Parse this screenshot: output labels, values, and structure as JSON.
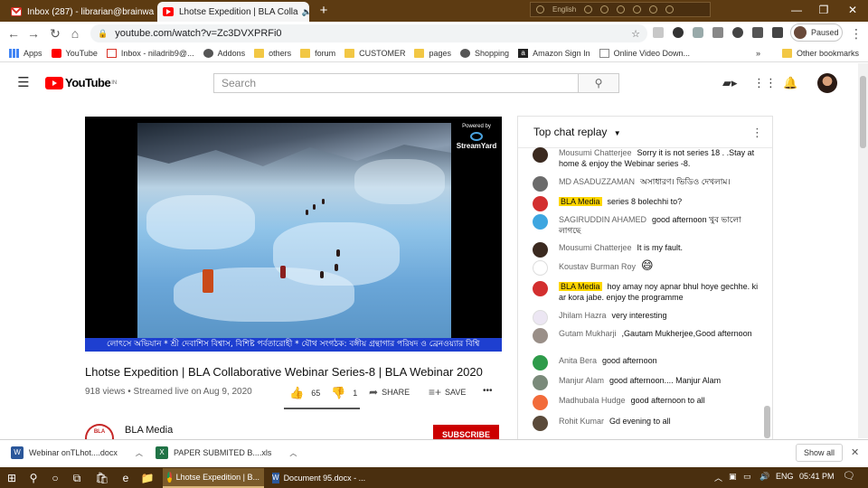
{
  "browser": {
    "tabs": [
      {
        "title": "Inbox (287) - librarian@brainwa",
        "active": false,
        "favicon": "gmail-icon"
      },
      {
        "title": "Lhotse Expedition | BLA Colla",
        "active": true,
        "favicon": "youtube-icon"
      }
    ],
    "new_tab": "+",
    "lang_label": "English",
    "url": "youtube.com/watch?v=Zc3DVXPRFi0",
    "profile_status": "Paused",
    "bookmarks": [
      {
        "label": "Apps",
        "icon": "apps-icon"
      },
      {
        "label": "YouTube",
        "icon": "youtube-icon"
      },
      {
        "label": "Inbox - niladrib9@...",
        "icon": "gmail-icon"
      },
      {
        "label": "Addons",
        "icon": "globe-icon"
      },
      {
        "label": "others",
        "icon": "folder-icon"
      },
      {
        "label": "forum",
        "icon": "folder-icon"
      },
      {
        "label": "CUSTOMER",
        "icon": "folder-icon"
      },
      {
        "label": "pages",
        "icon": "folder-icon"
      },
      {
        "label": "Shopping",
        "icon": "globe-icon"
      },
      {
        "label": "Amazon Sign In",
        "icon": "amazon-icon"
      },
      {
        "label": "Online Video Down...",
        "icon": "page-icon"
      }
    ],
    "other_bookmarks": "Other bookmarks",
    "more_bookmarks": "»"
  },
  "youtube": {
    "logo_text": "YouTube",
    "logo_region": "IN",
    "search_placeholder": "Search"
  },
  "video": {
    "powered_by": "Powered by",
    "brand": "StreamYard",
    "ticker": "লোৎসে অভিযান * শ্রী দেবাশিস বিশ্বাস, বিশিষ্ট পর্বতারোহী * যৌথ সংগঠক: বঙ্গীয় গ্রন্থাগার পরিষদ ও ব্রেনওয়্যার বিশ্বি",
    "title": "Lhotse Expedition | BLA Collaborative Webinar Series-8 | BLA Webinar 2020",
    "meta": "918 views • Streamed live on Aug 9, 2020",
    "likes": "65",
    "dislikes": "1",
    "share": "SHARE",
    "save": "SAVE",
    "more": "•••",
    "channel": "BLA Media",
    "subscribe": "SUBSCRIBE"
  },
  "chat": {
    "header": "Top chat replay",
    "messages": [
      {
        "author": "Mousumi Chatterjee",
        "text": "Sorry it is not series 18 . .Stay at home & enjoy the Webinar series -8.",
        "owner": false,
        "avatar_color": "#3b2a20"
      },
      {
        "author": "MD ASADUZZAMAN",
        "text": "অসাধারণ। ভিডিও দেখলাম।",
        "owner": false,
        "avatar_color": "#6b6b6b"
      },
      {
        "author": "BLA Media",
        "text": "series 8 bolechhi to?",
        "owner": true,
        "avatar_color": "#d32f2f"
      },
      {
        "author": "SAGIRUDDIN AHAMED",
        "text": "good afternoon খুব ভালো লাগছে",
        "owner": false,
        "avatar_color": "#3ea6e0"
      },
      {
        "author": "Mousumi Chatterjee",
        "text": "It is my fault.",
        "owner": false,
        "avatar_color": "#3b2a20"
      },
      {
        "author": "Koustav Burman Roy",
        "text": "😄",
        "owner": false,
        "avatar_color": "#ffffff"
      },
      {
        "author": "BLA Media",
        "text": "hoy amay noy apnar bhul hoye gechhe. ki ar kora jabe. enjoy the programme",
        "owner": true,
        "avatar_color": "#d32f2f"
      },
      {
        "author": "Jhilam Hazra",
        "text": "very interesting",
        "owner": false,
        "avatar_color": "#ece6f3"
      },
      {
        "author": "Gutam Mukharji",
        "text": ",Gautam Mukherjee,Good afternoon",
        "owner": false,
        "avatar_color": "#9a8f88"
      },
      {
        "author": "Anita Bera",
        "text": "good afternoon",
        "owner": false,
        "avatar_color": "#2e9b4a"
      },
      {
        "author": "Manjur Alam",
        "text": "good afternoon.... Manjur Alam",
        "owner": false,
        "avatar_color": "#7a8a7a"
      },
      {
        "author": "Madhubala Hudge",
        "text": "good afternoon to all",
        "owner": false,
        "avatar_color": "#f26b3a"
      },
      {
        "author": "Rohit Kumar",
        "text": "Gd evening to all",
        "owner": false,
        "avatar_color": "#5a4a3a"
      }
    ]
  },
  "downloads": {
    "items": [
      {
        "name": "Webinar onTLhot....docx",
        "type": "word"
      },
      {
        "name": "PAPER SUBMITED B....xls",
        "type": "excel"
      }
    ],
    "show_all": "Show all"
  },
  "taskbar": {
    "apps": [
      {
        "label": "Lhotse Expedition | B...",
        "active": true
      },
      {
        "label": "Document 95.docx - ...",
        "active": false
      }
    ],
    "lang": "ENG",
    "time": "05:41 PM"
  }
}
